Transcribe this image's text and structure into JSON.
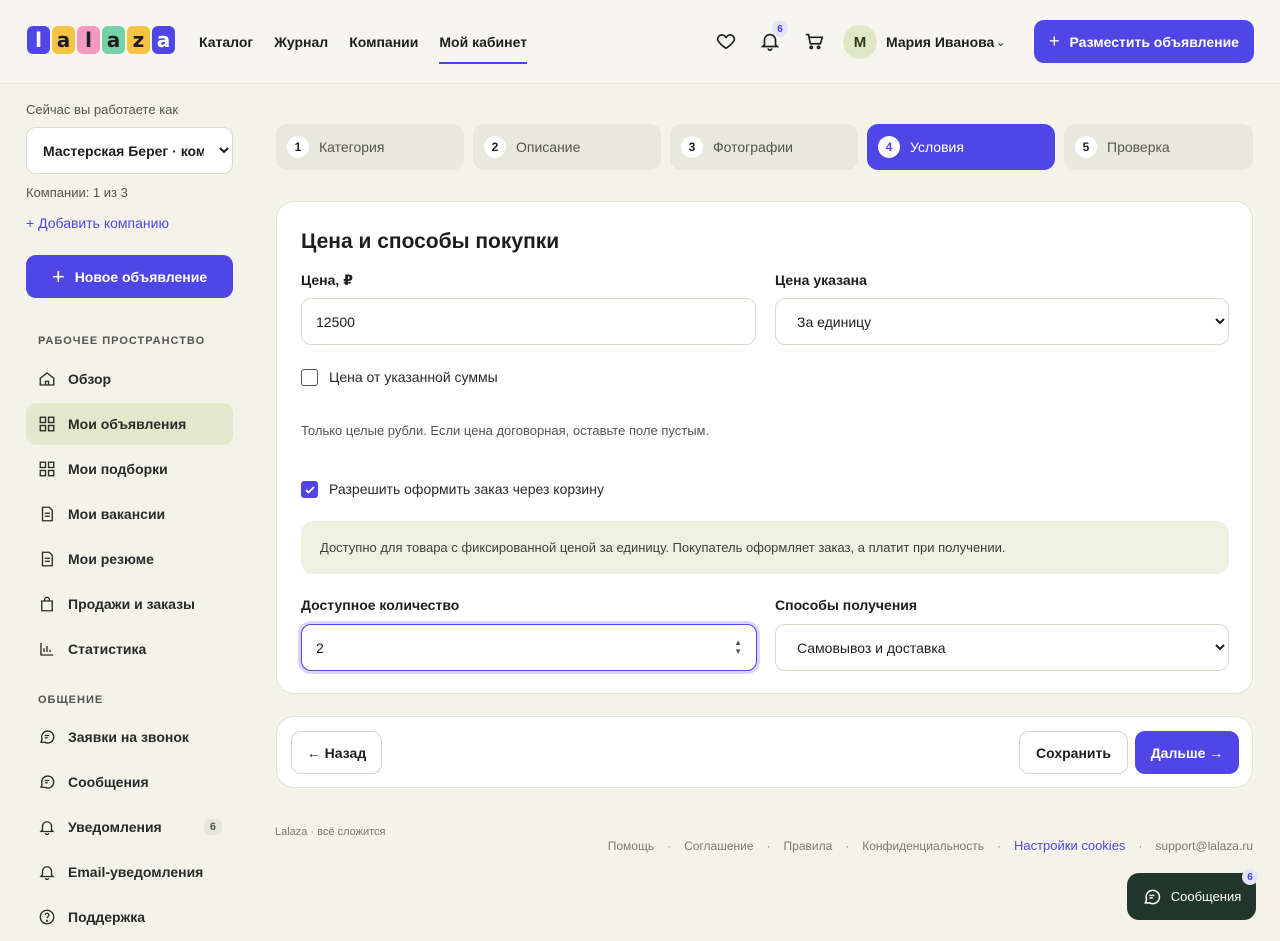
{
  "header": {
    "logo_letters": [
      "l",
      "a",
      "l",
      "a",
      "z",
      "a"
    ],
    "logo_colors": [
      "#4f46e5",
      "#f6c343",
      "#f49ac1",
      "#74d1a8",
      "#f6c343",
      "#4f46e5"
    ],
    "nav": [
      {
        "label": "Каталог"
      },
      {
        "label": "Журнал"
      },
      {
        "label": "Компании"
      },
      {
        "label": "Мой кабинет",
        "active": true
      }
    ],
    "notifications_count": "6",
    "user": {
      "initial": "М",
      "name": "Мария Иванова"
    },
    "post_button": "Разместить объявление"
  },
  "sidebar": {
    "working_as": "Сейчас вы работаете как",
    "company": "Мастерская Берег · ком",
    "companies_count": "Компании: 1 из 3",
    "add_company": "+ Добавить компанию",
    "new_ad": "Новое объявление",
    "workspace_title": "РАБОЧЕЕ ПРОСТРАНСТВО",
    "workspace_items": [
      {
        "label": "Обзор",
        "icon": "home-icon"
      },
      {
        "label": "Мои объявления",
        "icon": "grid-icon",
        "active": true
      },
      {
        "label": "Мои подборки",
        "icon": "grid-icon"
      },
      {
        "label": "Мои вакансии",
        "icon": "document-icon"
      },
      {
        "label": "Мои резюме",
        "icon": "document-icon"
      },
      {
        "label": "Продажи и заказы",
        "icon": "bag-icon"
      },
      {
        "label": "Статистика",
        "icon": "chart-icon"
      }
    ],
    "communication_title": "ОБЩЕНИЕ",
    "communication_items": [
      {
        "label": "Заявки на звонок",
        "icon": "chat-icon"
      },
      {
        "label": "Сообщения",
        "icon": "chat-icon"
      },
      {
        "label": "Уведомления",
        "icon": "bell-icon",
        "count": "6"
      },
      {
        "label": "Email-уведомления",
        "icon": "bell-icon"
      },
      {
        "label": "Поддержка",
        "icon": "help-icon"
      }
    ]
  },
  "steps": [
    {
      "num": "1",
      "label": "Категория"
    },
    {
      "num": "2",
      "label": "Описание"
    },
    {
      "num": "3",
      "label": "Фотографии"
    },
    {
      "num": "4",
      "label": "Условия",
      "active": true
    },
    {
      "num": "5",
      "label": "Проверка"
    }
  ],
  "form": {
    "title": "Цена и способы покупки",
    "price_label": "Цена, ₽",
    "price_value": "12500",
    "price_type_label": "Цена указана",
    "price_type_value": "За единицу",
    "price_from_label": "Цена от указанной суммы",
    "price_from_checked": false,
    "price_hint": "Только целые рубли. Если цена договорная, оставьте поле пустым.",
    "cart_label": "Разрешить оформить заказ через корзину",
    "cart_checked": true,
    "cart_info": "Доступно для товара с фиксированной ценой за единицу. Покупатель оформляет заказ, а платит при получении.",
    "quantity_label": "Доступное количество",
    "quantity_value": "2",
    "delivery_label": "Способы получения",
    "delivery_value": "Самовывоз и доставка"
  },
  "actions": {
    "back": "← Назад",
    "save": "Сохранить",
    "next": "Дальше →"
  },
  "footer": {
    "brand": "Lalaza · всё сложится",
    "links": [
      "Помощь",
      "Соглашение",
      "Правила",
      "Конфиденциальность",
      "Настройки cookies",
      "support@lalaza.ru"
    ],
    "chat_button": "Сообщения",
    "chat_count": "6"
  },
  "colors": {
    "accent": "#4f46e5",
    "active_menu": "#e3e8cc",
    "chat_button": "#22362b"
  }
}
